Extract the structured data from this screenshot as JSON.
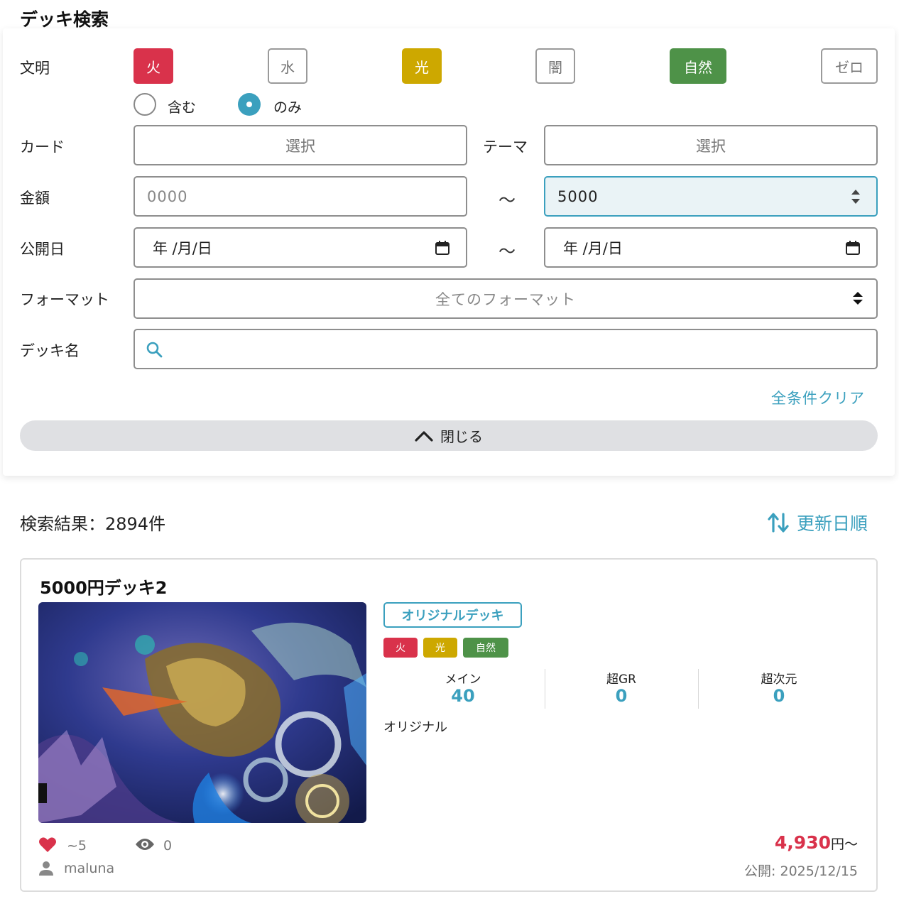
{
  "title": "デッキ検索",
  "filters": {
    "civ_label": "文明",
    "civs": [
      {
        "label": "火",
        "state": "on",
        "color": "#d9324b"
      },
      {
        "label": "水",
        "state": "off"
      },
      {
        "label": "光",
        "state": "on",
        "color": "#cda800"
      },
      {
        "label": "闇",
        "state": "off"
      },
      {
        "label": "自然",
        "state": "on",
        "color": "#4e9248"
      },
      {
        "label": "ゼロ",
        "state": "off"
      }
    ],
    "match_options": [
      {
        "label": "含む",
        "selected": false
      },
      {
        "label": "のみ",
        "selected": true
      }
    ],
    "card_label": "カード",
    "card_select": "選択",
    "theme_label": "テーマ",
    "theme_select": "選択",
    "price_label": "金額",
    "price_min_placeholder": "0000",
    "price_max_value": "5000",
    "range_sep": "〜",
    "date_label": "公開日",
    "date_from": "年 /月/日",
    "date_to": "年 /月/日",
    "format_label": "フォーマット",
    "format_value": "全てのフォーマット",
    "deckname_label": "デッキ名",
    "deckname_value": "",
    "clear_label": "全条件クリア",
    "close_label": "閉じる"
  },
  "results": {
    "count_text": "検索結果：2894件",
    "sort_label": "更新日順"
  },
  "deck": {
    "name": "5000円デッキ2",
    "type_badge": "オリジナルデッキ",
    "civ_badges": [
      {
        "label": "火",
        "color": "#d9324b"
      },
      {
        "label": "光",
        "color": "#cda800"
      },
      {
        "label": "自然",
        "color": "#4e9248"
      }
    ],
    "stats": [
      {
        "label": "メイン",
        "value": "40"
      },
      {
        "label": "超GR",
        "value": "0"
      },
      {
        "label": "超次元",
        "value": "0"
      }
    ],
    "theme": "オリジナル",
    "likes": "~5",
    "views": "0",
    "author": "maluna",
    "price": "4,930",
    "price_unit": "円〜",
    "published": "公開: 2025/12/15"
  },
  "colors": {
    "accent": "#3ba0be",
    "fire": "#d9324b",
    "light": "#cda800",
    "nature": "#4e9248"
  }
}
